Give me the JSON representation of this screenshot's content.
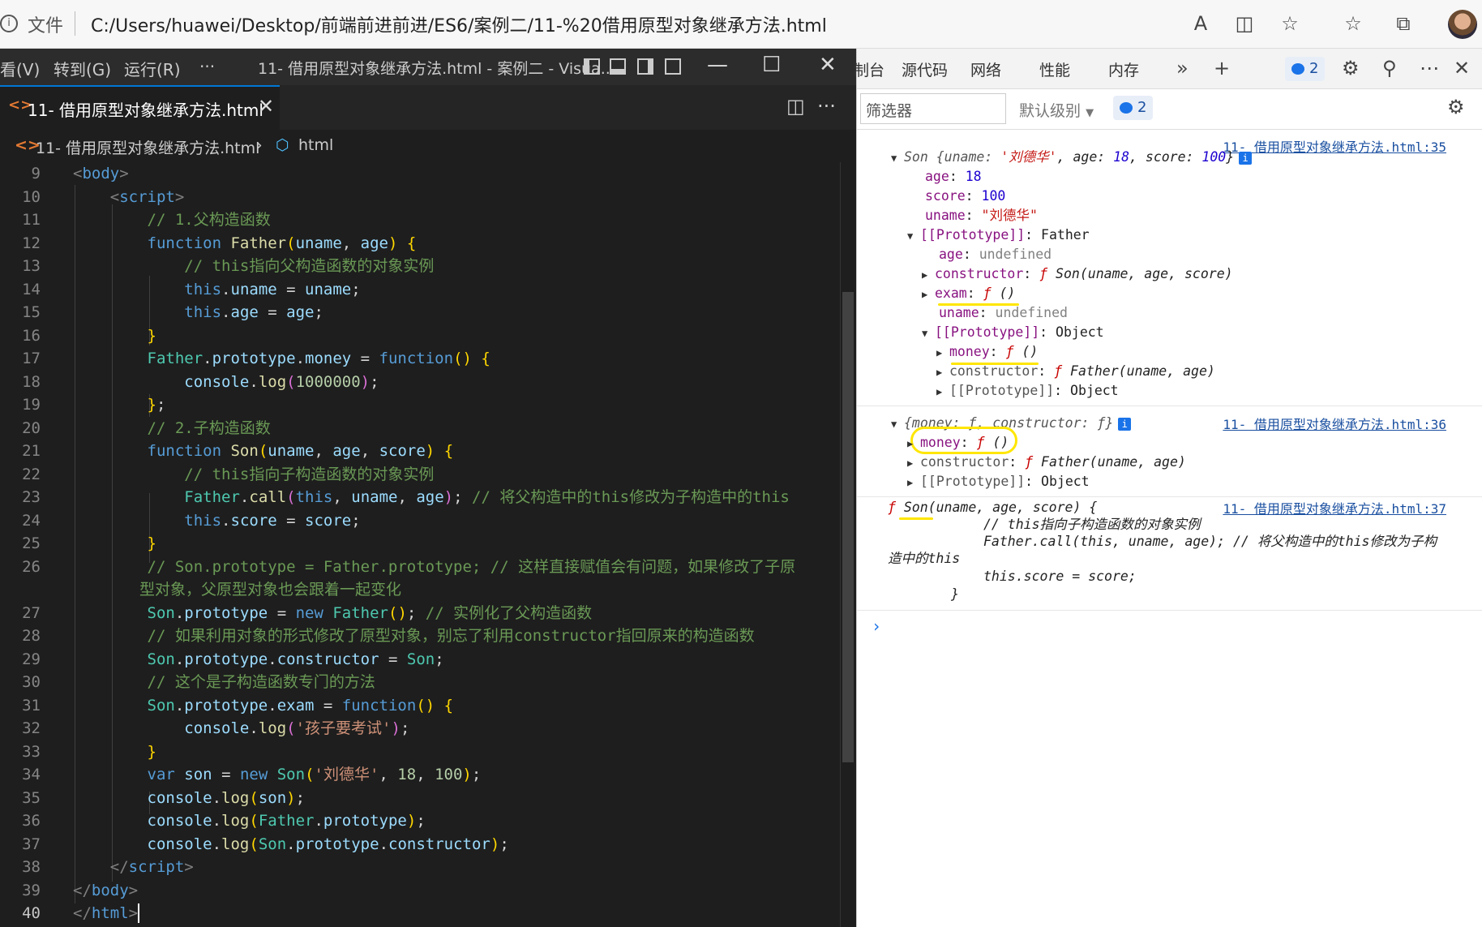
{
  "browser": {
    "info_icon": "info-icon",
    "file_label": "文件",
    "url": "C:/Users/huawei/Desktop/前端前进前进/ES6/案例二/11-%20借用原型对象继承方法.html"
  },
  "vscode": {
    "menu": [
      "看(V)",
      "转到(G)",
      "运行(R)",
      "···"
    ],
    "title": "11- 借用原型对象继承方法.html - 案例二 - Visua...",
    "tab_label": "11- 借用原型对象继承方法.html",
    "breadcrumb_file": "11- 借用原型对象继承方法.html",
    "breadcrumb_node": "html",
    "active_line": 40
  },
  "devtools": {
    "tabs": [
      "制台",
      "源代码",
      "网络",
      "性能",
      "内存"
    ],
    "issue_count": "2",
    "filter_placeholder": "筛选器",
    "level": "默认级别",
    "message_count": "2",
    "log1": {
      "source": "11- 借用原型对象继承方法.html:35",
      "summary_prefix": "Son {uname: ",
      "summary_uname": "'刘德华'",
      "summary_mid": ", age: ",
      "summary_age": "18",
      "summary_mid2": ", score: ",
      "summary_score": "100",
      "summary_end": "}",
      "age": "18",
      "score": "100",
      "uname": "\"刘德华\"",
      "proto_label": "[[Prototype]]",
      "proto_value": "Father",
      "undefined": "undefined",
      "constructor_sig": "Son(uname, age, score)",
      "exam_sig": "()",
      "inner_proto_value": "Object",
      "money_sig": "()",
      "father_sig": "Father(uname, age)",
      "obj": "Object"
    },
    "log2": {
      "source": "11- 借用原型对象继承方法.html:36",
      "summary": "{money: ƒ, constructor: ƒ}",
      "money_sig": "()",
      "father_sig": "Father(uname, age)",
      "obj": "Object"
    },
    "log3": {
      "source": "11- 借用原型对象继承方法.html:37",
      "l1": "Son(uname, age, score) {",
      "l2": "// this指向子构造函数的对象实例",
      "l3": "Father.call(this, uname, age); // 将父构造中的this修改为子构",
      "l4": "造中的this",
      "l5": "this.score = score;",
      "l6": "}"
    }
  }
}
